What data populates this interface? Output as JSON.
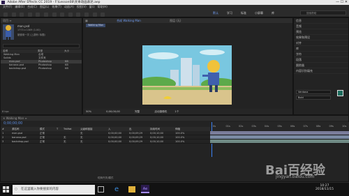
{
  "window": {
    "title": "Adobe After Effects CC 2019 - F:\\Lesson08\\文本动画表达.aep"
  },
  "menu": [
    "文件(F)",
    "编辑(E)",
    "合成(C)",
    "图层(L)",
    "效果(T)",
    "动画(A)",
    "视图(V)",
    "窗口",
    "帮助(H)"
  ],
  "workspace": {
    "items": [
      "默认",
      "学习",
      "标准",
      "小屏幕",
      "库"
    ],
    "search_placeholder": "搜索帮助"
  },
  "project": {
    "tab": "项目",
    "asset_name": "man.psd",
    "asset_info": "1773 x 1309 (1.00)",
    "asset_usage": "被使用一次 (上游例: 标题)",
    "columns": [
      "名称",
      "类型",
      "大小"
    ],
    "items": [
      {
        "name": "Walking Man",
        "type": "合成",
        "size": ""
      },
      {
        "name": "Solids",
        "type": "文件夹",
        "size": ""
      },
      {
        "name": "man.psd",
        "type": "Photoshop",
        "size": "KB"
      },
      {
        "name": "banana.psd",
        "type": "Photoshop",
        "size": "KB"
      },
      {
        "name": "backdrop.psd",
        "type": "Photoshop",
        "size": "KB"
      }
    ],
    "bpc": "8 bpc"
  },
  "composition": {
    "tab_label": "合成 Walking Man",
    "layer_tab": "图层 (无)",
    "breadcrumb": "Walking Man",
    "zoom": "50%",
    "timecode": "0;00;00;00",
    "resolution": "完整",
    "camera": "活动摄像机",
    "views": "1个"
  },
  "right_panel": {
    "items": [
      "信息",
      "音频",
      "预览",
      "效果和预设",
      "对齐",
      "库",
      "字符",
      "段落",
      "跟踪器",
      "内容识别填充"
    ],
    "font": "Verdana",
    "font_style": "Bold"
  },
  "timeline": {
    "tab": "Walking Man",
    "timecode": "0;00;00;00",
    "headers": [
      "#",
      "源名称",
      "模式",
      "T",
      "TrkMat",
      "父级和链接",
      "入",
      "出",
      "持续时间",
      "伸缩"
    ],
    "layers": [
      {
        "num": "1",
        "name": "man.psd",
        "mode": "正常",
        "trkmat": "",
        "parent": "无",
        "in": "0;00;00;00",
        "out": "0;00;09;29",
        "dur": "0;00;10;00",
        "stretch": "100.0%"
      },
      {
        "num": "2",
        "name": "banana.psd",
        "mode": "正常",
        "trkmat": "无",
        "parent": "无",
        "in": "0;00;00;00",
        "out": "0;00;09;29",
        "dur": "0;00;10;00",
        "stretch": "100.0%"
      },
      {
        "num": "3",
        "name": "backdrop.psd",
        "mode": "正常",
        "trkmat": "无",
        "parent": "无",
        "in": "0;00;00;00",
        "out": "0;00;09;29",
        "dur": "0;00;10;00",
        "stretch": "100.0%"
      }
    ],
    "ruler": [
      "0s",
      "01s",
      "02s",
      "03s",
      "04s",
      "05s",
      "06s",
      "07s",
      "08s",
      "09s",
      "10s"
    ],
    "footer": "切换开关/模式"
  },
  "taskbar": {
    "search_placeholder": "在这里输入你要搜索的内容",
    "time": "10:27",
    "date": "2018/11/15"
  },
  "watermark": {
    "brand": "Bai百经验",
    "url": "jingyan.baidu.com"
  }
}
